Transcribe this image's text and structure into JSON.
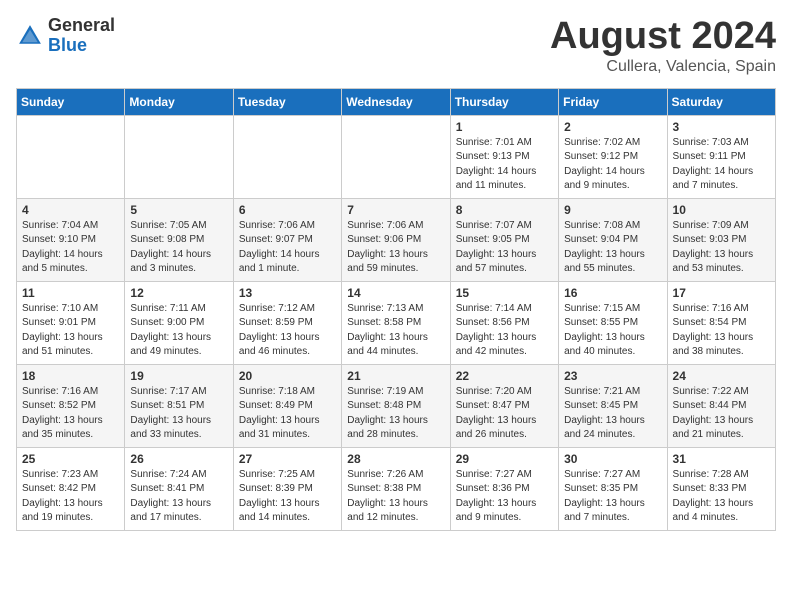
{
  "header": {
    "logo_general": "General",
    "logo_blue": "Blue",
    "title": "August 2024",
    "subtitle": "Cullera, Valencia, Spain"
  },
  "days_of_week": [
    "Sunday",
    "Monday",
    "Tuesday",
    "Wednesday",
    "Thursday",
    "Friday",
    "Saturday"
  ],
  "weeks": [
    {
      "days": [
        {
          "num": "",
          "info": ""
        },
        {
          "num": "",
          "info": ""
        },
        {
          "num": "",
          "info": ""
        },
        {
          "num": "",
          "info": ""
        },
        {
          "num": "1",
          "info": "Sunrise: 7:01 AM\nSunset: 9:13 PM\nDaylight: 14 hours\nand 11 minutes."
        },
        {
          "num": "2",
          "info": "Sunrise: 7:02 AM\nSunset: 9:12 PM\nDaylight: 14 hours\nand 9 minutes."
        },
        {
          "num": "3",
          "info": "Sunrise: 7:03 AM\nSunset: 9:11 PM\nDaylight: 14 hours\nand 7 minutes."
        }
      ]
    },
    {
      "days": [
        {
          "num": "4",
          "info": "Sunrise: 7:04 AM\nSunset: 9:10 PM\nDaylight: 14 hours\nand 5 minutes."
        },
        {
          "num": "5",
          "info": "Sunrise: 7:05 AM\nSunset: 9:08 PM\nDaylight: 14 hours\nand 3 minutes."
        },
        {
          "num": "6",
          "info": "Sunrise: 7:06 AM\nSunset: 9:07 PM\nDaylight: 14 hours\nand 1 minute."
        },
        {
          "num": "7",
          "info": "Sunrise: 7:06 AM\nSunset: 9:06 PM\nDaylight: 13 hours\nand 59 minutes."
        },
        {
          "num": "8",
          "info": "Sunrise: 7:07 AM\nSunset: 9:05 PM\nDaylight: 13 hours\nand 57 minutes."
        },
        {
          "num": "9",
          "info": "Sunrise: 7:08 AM\nSunset: 9:04 PM\nDaylight: 13 hours\nand 55 minutes."
        },
        {
          "num": "10",
          "info": "Sunrise: 7:09 AM\nSunset: 9:03 PM\nDaylight: 13 hours\nand 53 minutes."
        }
      ]
    },
    {
      "days": [
        {
          "num": "11",
          "info": "Sunrise: 7:10 AM\nSunset: 9:01 PM\nDaylight: 13 hours\nand 51 minutes."
        },
        {
          "num": "12",
          "info": "Sunrise: 7:11 AM\nSunset: 9:00 PM\nDaylight: 13 hours\nand 49 minutes."
        },
        {
          "num": "13",
          "info": "Sunrise: 7:12 AM\nSunset: 8:59 PM\nDaylight: 13 hours\nand 46 minutes."
        },
        {
          "num": "14",
          "info": "Sunrise: 7:13 AM\nSunset: 8:58 PM\nDaylight: 13 hours\nand 44 minutes."
        },
        {
          "num": "15",
          "info": "Sunrise: 7:14 AM\nSunset: 8:56 PM\nDaylight: 13 hours\nand 42 minutes."
        },
        {
          "num": "16",
          "info": "Sunrise: 7:15 AM\nSunset: 8:55 PM\nDaylight: 13 hours\nand 40 minutes."
        },
        {
          "num": "17",
          "info": "Sunrise: 7:16 AM\nSunset: 8:54 PM\nDaylight: 13 hours\nand 38 minutes."
        }
      ]
    },
    {
      "days": [
        {
          "num": "18",
          "info": "Sunrise: 7:16 AM\nSunset: 8:52 PM\nDaylight: 13 hours\nand 35 minutes."
        },
        {
          "num": "19",
          "info": "Sunrise: 7:17 AM\nSunset: 8:51 PM\nDaylight: 13 hours\nand 33 minutes."
        },
        {
          "num": "20",
          "info": "Sunrise: 7:18 AM\nSunset: 8:49 PM\nDaylight: 13 hours\nand 31 minutes."
        },
        {
          "num": "21",
          "info": "Sunrise: 7:19 AM\nSunset: 8:48 PM\nDaylight: 13 hours\nand 28 minutes."
        },
        {
          "num": "22",
          "info": "Sunrise: 7:20 AM\nSunset: 8:47 PM\nDaylight: 13 hours\nand 26 minutes."
        },
        {
          "num": "23",
          "info": "Sunrise: 7:21 AM\nSunset: 8:45 PM\nDaylight: 13 hours\nand 24 minutes."
        },
        {
          "num": "24",
          "info": "Sunrise: 7:22 AM\nSunset: 8:44 PM\nDaylight: 13 hours\nand 21 minutes."
        }
      ]
    },
    {
      "days": [
        {
          "num": "25",
          "info": "Sunrise: 7:23 AM\nSunset: 8:42 PM\nDaylight: 13 hours\nand 19 minutes."
        },
        {
          "num": "26",
          "info": "Sunrise: 7:24 AM\nSunset: 8:41 PM\nDaylight: 13 hours\nand 17 minutes."
        },
        {
          "num": "27",
          "info": "Sunrise: 7:25 AM\nSunset: 8:39 PM\nDaylight: 13 hours\nand 14 minutes."
        },
        {
          "num": "28",
          "info": "Sunrise: 7:26 AM\nSunset: 8:38 PM\nDaylight: 13 hours\nand 12 minutes."
        },
        {
          "num": "29",
          "info": "Sunrise: 7:27 AM\nSunset: 8:36 PM\nDaylight: 13 hours\nand 9 minutes."
        },
        {
          "num": "30",
          "info": "Sunrise: 7:27 AM\nSunset: 8:35 PM\nDaylight: 13 hours\nand 7 minutes."
        },
        {
          "num": "31",
          "info": "Sunrise: 7:28 AM\nSunset: 8:33 PM\nDaylight: 13 hours\nand 4 minutes."
        }
      ]
    }
  ]
}
